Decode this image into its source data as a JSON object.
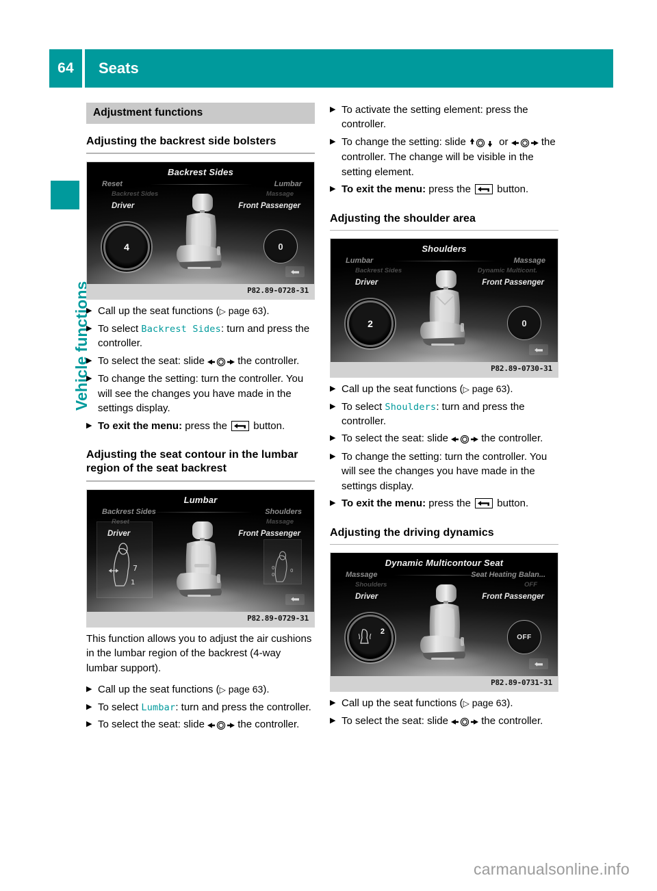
{
  "theme": {
    "accent": "#009a9c",
    "grey_head_bg": "#c9c9c9",
    "caption_bg": "#d2d2d2"
  },
  "header": {
    "page_number": "64",
    "title": "Seats"
  },
  "sidebar": {
    "chapter_label": "Vehicle functions"
  },
  "section_title": "Adjustment functions",
  "left_column": {
    "heading_1": "Adjusting the backrest side bolsters",
    "figure_1": {
      "title": "Backrest Sides",
      "left_label": "Reset",
      "left_sub": "Backrest Sides",
      "right_label": "Lumbar",
      "right_sub": "Massage",
      "driver_label": "Driver",
      "passenger_label": "Front Passenger",
      "driver_value": "4",
      "passenger_value": "0",
      "caption": "P82.89-0728-31"
    },
    "steps_1": [
      {
        "text_before": "Call up the seat functions (",
        "ref": "page 63",
        "text_after": ")."
      },
      {
        "text_before": "To select ",
        "mono": "Backrest Sides",
        "text_after": ": turn and press the controller."
      },
      {
        "text_before": "To select the seat: slide ",
        "glyph": "slide-lr",
        "text_after": " the controller."
      },
      {
        "text_before": "To change the setting: turn the controller. You will see the changes you have made in the settings display."
      },
      {
        "bold": "To exit the menu:",
        "text_before": " press the ",
        "glyph": "back-button",
        "text_after": " button."
      }
    ],
    "heading_2": "Adjusting the seat contour in the lumbar region of the seat backrest",
    "figure_2": {
      "title": "Lumbar",
      "left_label": "Backrest Sides",
      "left_sub": "Reset",
      "right_label": "Shoulders",
      "right_sub": "Massage",
      "driver_label": "Driver",
      "passenger_label": "Front Passenger",
      "driver_value": "",
      "passenger_value": "",
      "caption": "P82.89-0729-31"
    },
    "paragraph": "This function allows you to adjust the air cushions in the lumbar region of the backrest (4-way lumbar support).",
    "steps_2": [
      {
        "text_before": "Call up the seat functions (",
        "ref": "page 63",
        "text_after": ")."
      },
      {
        "text_before": "To select ",
        "mono": "Lumbar",
        "text_after": ": turn and press the controller."
      },
      {
        "text_before": "To select the seat: slide ",
        "glyph": "slide-lr",
        "text_after": " the controller."
      }
    ]
  },
  "right_column": {
    "steps_top": [
      {
        "text_before": "To activate the setting element: press the controller."
      },
      {
        "text_before": "To change the setting: slide ",
        "glyph": "slide-ud",
        "mid": " or ",
        "glyph2": "slide-lr",
        "text_after": " the controller.",
        "extra_line": "The change will be visible in the setting element."
      },
      {
        "bold": "To exit the menu:",
        "text_before": " press the ",
        "glyph": "back-button",
        "text_after": " button."
      }
    ],
    "heading_1": "Adjusting the shoulder area",
    "figure_1": {
      "title": "Shoulders",
      "left_label": "Lumbar",
      "left_sub": "Backrest Sides",
      "right_label": "Massage",
      "right_sub": "Dynamic Multicont.",
      "driver_label": "Driver",
      "passenger_label": "Front Passenger",
      "driver_value": "2",
      "passenger_value": "0",
      "caption": "P82.89-0730-31"
    },
    "steps_1": [
      {
        "text_before": "Call up the seat functions (",
        "ref": "page 63",
        "text_after": ")."
      },
      {
        "text_before": "To select ",
        "mono": "Shoulders",
        "text_after": ": turn and press the controller."
      },
      {
        "text_before": "To select the seat: slide ",
        "glyph": "slide-lr",
        "text_after": " the controller."
      },
      {
        "text_before": "To change the setting: turn the controller. You will see the changes you have made in the settings display."
      },
      {
        "bold": "To exit the menu:",
        "text_before": " press the ",
        "glyph": "back-button",
        "text_after": " button."
      }
    ],
    "heading_2": "Adjusting the driving dynamics",
    "figure_2": {
      "title": "Dynamic Multicontour Seat",
      "left_label": "Massage",
      "left_sub": "Shoulders",
      "right_label": "Seat Heating Balan...",
      "right_sub": "OFF",
      "driver_label": "Driver",
      "passenger_label": "Front Passenger",
      "driver_value": "2",
      "passenger_value": "OFF",
      "caption": "P82.89-0731-31"
    },
    "steps_2": [
      {
        "text_before": "Call up the seat functions (",
        "ref": "page 63",
        "text_after": ")."
      },
      {
        "text_before": "To select the seat: slide ",
        "glyph": "slide-lr",
        "text_after": " the controller."
      }
    ]
  },
  "watermark": "carmanualsonline.info",
  "glyph_labels": {
    "bullet": "▶",
    "ref_arrow": "▷"
  }
}
